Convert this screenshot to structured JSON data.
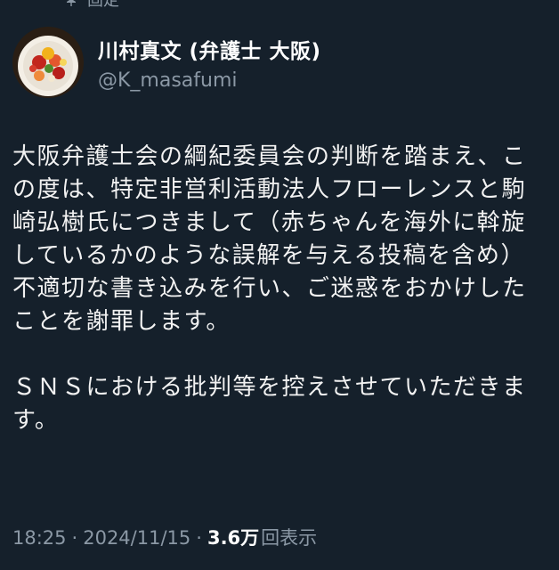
{
  "pinned": {
    "label": "固定"
  },
  "author": {
    "display_name": "川村真文 (弁護士 大阪)",
    "handle": "@K_masafumi"
  },
  "tweet": {
    "paragraph_1": "大阪弁護士会の綱紀委員会の判断を踏まえ、この度は、特定非営利活動法人フローレンスと駒崎弘樹氏につきまして（赤ちゃんを海外に斡旋しているかのような誤解を与える投稿を含め）不適切な書き込みを行い、ご迷惑をおかけしたことを謝罪します。",
    "paragraph_2": "ＳＮＳにおける批判等を控えさせていただきます。"
  },
  "meta": {
    "time": "18:25",
    "separator_1": "·",
    "date": "2024/11/15",
    "separator_2": "·",
    "views_count": "3.6万",
    "views_label": "回表示"
  },
  "colors": {
    "background": "#15202b",
    "text_primary": "#ffffff",
    "text_secondary": "#8b98a5"
  }
}
